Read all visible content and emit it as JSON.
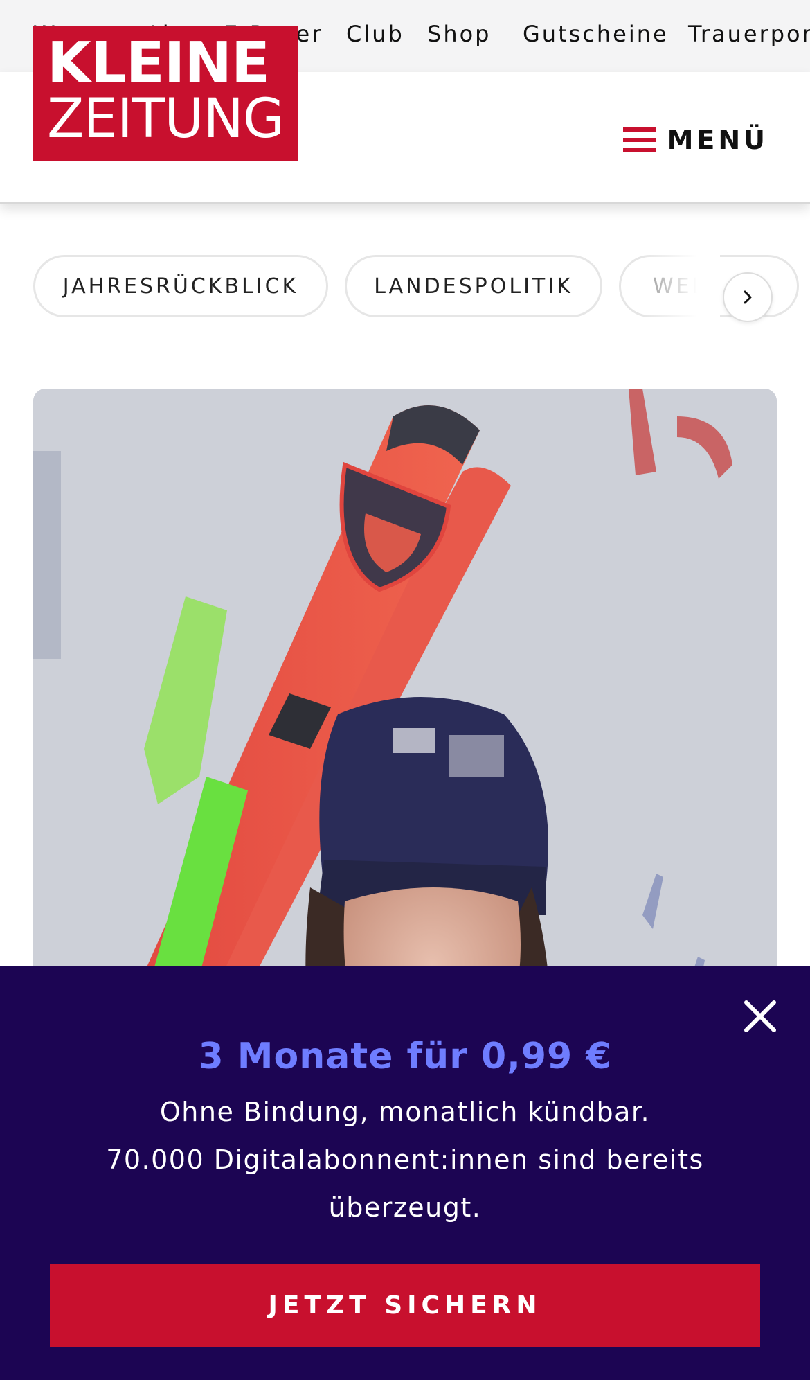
{
  "utility_nav": {
    "items": [
      "Wetter",
      "Abo",
      "E-Paper",
      "Club",
      "Shop",
      "Gutscheine",
      "Trauerportal"
    ]
  },
  "header": {
    "logo_line1": "KLEINE",
    "logo_line2": "ZEITUNG",
    "menu_label": "MENÜ"
  },
  "tags": {
    "items": [
      "JAHRESRÜCKBLICK",
      "LANDESPOLITIK",
      "WELT"
    ]
  },
  "promo": {
    "headline": "3 Monate für 0,99 €",
    "line1": "Ohne Bindung, monatlich kündbar.",
    "line2": "70.000 Digitalabonnent:innen sind bereits überzeugt.",
    "cta": "JETZT SICHERN"
  },
  "colors": {
    "brand_red": "#c8102e",
    "promo_bg": "#1c0553",
    "promo_accent": "#6f7dff"
  },
  "icons": {
    "menu": "hamburger-icon",
    "scroll": "chevron-right-icon",
    "close": "close-icon"
  }
}
